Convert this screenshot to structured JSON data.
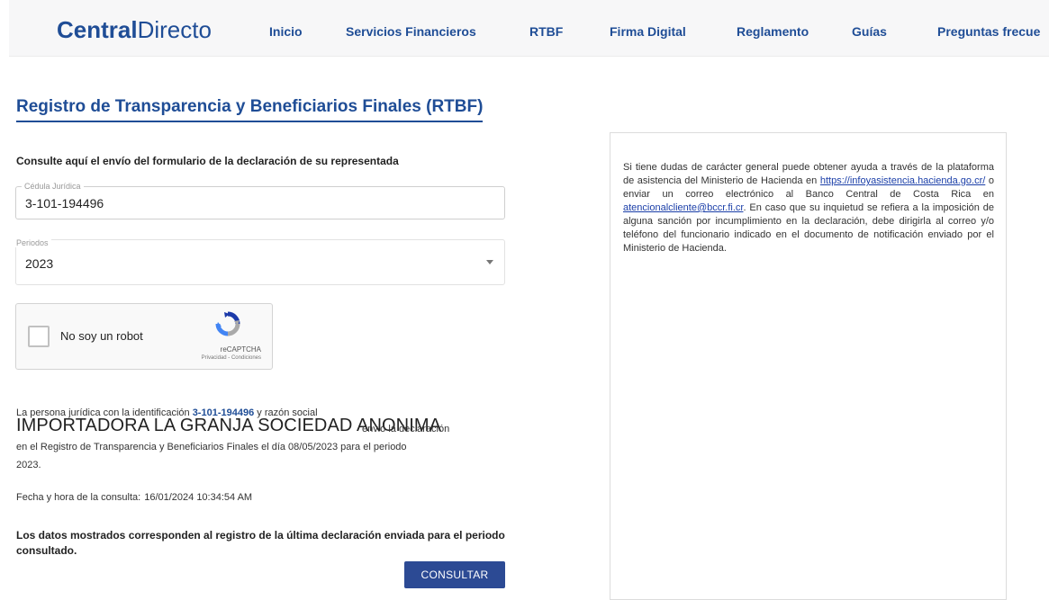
{
  "header": {
    "logo_bold": "Central",
    "logo_light": "Directo",
    "nav": [
      "Inicio",
      "Servicios Financieros",
      "RTBF",
      "Firma Digital",
      "Reglamento",
      "Guías",
      "Preguntas frecue"
    ]
  },
  "page": {
    "title": "Registro de Transparencia y Beneficiarios Finales (RTBF)",
    "subtitle": "Consulte aquí el envío del formulario de la declaración de su representada"
  },
  "form": {
    "cedula_label": "Cédula Jurídica",
    "cedula_value": "3-101-194496",
    "periodo_label": "Periodos",
    "periodo_value": "2023"
  },
  "captcha": {
    "label": "No soy un robot",
    "brand": "reCAPTCHA",
    "links": "Privacidad - Condiciones"
  },
  "result": {
    "line1_prefix": "La persona jurídica con la identificación",
    "identification": "3-101-194496",
    "line1_suffix": "y razón social",
    "company": "IMPORTADORA LA GRANJA SOCIEDAD ANONIMA",
    "company_tail": "envió la declaración",
    "line3": "en el Registro de Transparencia y Beneficiarios Finales el día 08/05/2023 para el periodo",
    "line4": "2023.",
    "consult_label": "Fecha y hora de la consulta:",
    "consult_value": "16/01/2024 10:34:54 AM",
    "notice": "Los datos mostrados corresponden al registro de la última declaración enviada para el periodo consultado."
  },
  "button": {
    "consultar": "CONSULTAR"
  },
  "info": {
    "t1": "Si tiene dudas de carácter general puede obtener ayuda a través de la plataforma de asistencia del Ministerio de Hacienda en ",
    "link1": "https://infoyasistencia.hacienda.go.cr/",
    "t2": " o enviar un correo electrónico al Banco Central de Costa Rica en ",
    "link2": "atencionalcliente@bccr.fi.cr",
    "t3": ". En caso que su inquietud se refiera a la imposición de alguna sanción por incumplimiento en la declaración, debe dirigirla al correo y/o teléfono del funcionario indicado en el documento de notificación enviado por el Ministerio de Hacienda."
  },
  "colors": {
    "brand": "#1f4d96",
    "button": "#2c4a94",
    "link": "#1a3ea8"
  }
}
